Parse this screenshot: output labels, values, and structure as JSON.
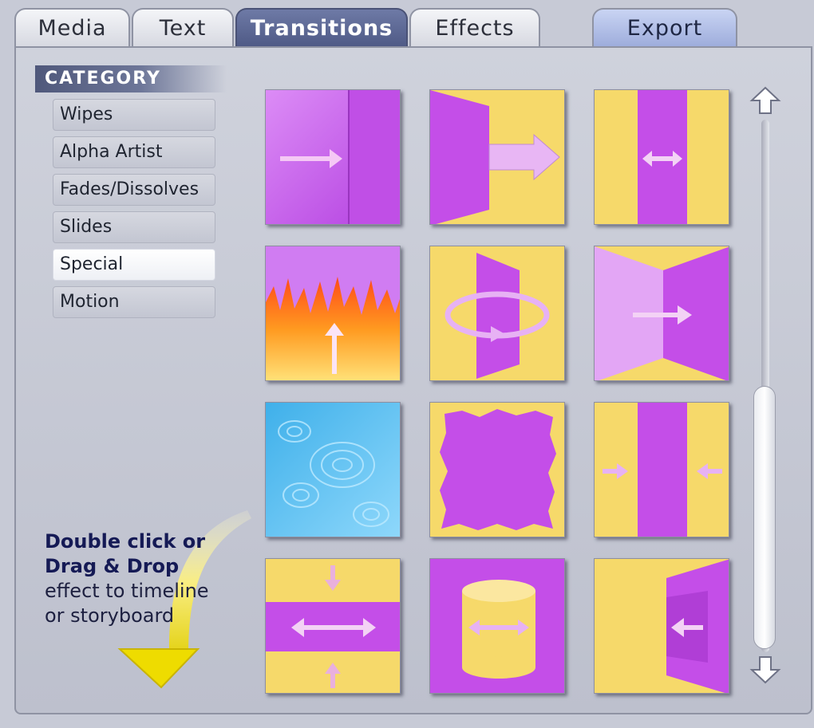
{
  "tabs": {
    "media": "Media",
    "text": "Text",
    "transitions": "Transitions",
    "effects": "Effects",
    "export": "Export"
  },
  "category": {
    "header": "CATEGORY",
    "items": [
      "Wipes",
      "Alpha Artist",
      "Fades/Dissolves",
      "Slides",
      "Special",
      "Motion"
    ],
    "selected": "Special"
  },
  "hint": {
    "line1": "Double click or",
    "line2": "Drag & Drop",
    "line3": "effect to timeline",
    "line4": "or storyboard"
  },
  "transitions": [
    {
      "icon": "wipe-right-icon"
    },
    {
      "icon": "door-slide-right-icon"
    },
    {
      "icon": "center-stretch-icon"
    },
    {
      "icon": "flame-up-icon"
    },
    {
      "icon": "page-rotate-icon"
    },
    {
      "icon": "bow-tie-right-icon"
    },
    {
      "icon": "water-ripple-icon"
    },
    {
      "icon": "torn-paper-icon"
    },
    {
      "icon": "squeeze-center-icon"
    },
    {
      "icon": "horizontal-band-icon"
    },
    {
      "icon": "cylinder-rotate-icon"
    },
    {
      "icon": "door-slide-left-icon"
    }
  ],
  "colors": {
    "purple": "#c44ee8",
    "light_purple": "#e3a6f5",
    "yellow": "#f6d96a",
    "active_tab": "#5b6691",
    "panel": "#c7cad6"
  }
}
